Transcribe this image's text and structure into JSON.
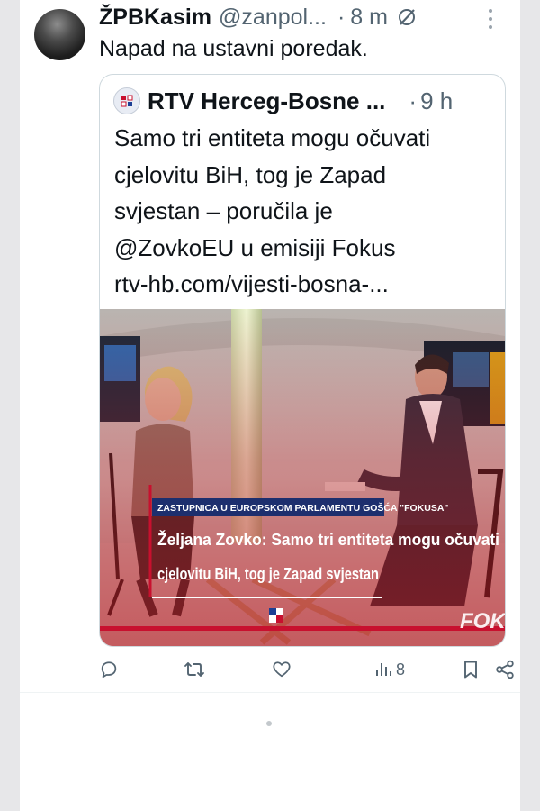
{
  "tweet": {
    "author_name": "ŽPBKasim",
    "author_handle": "@zanpol...",
    "separator": "·",
    "time": "8 m",
    "text": "Napad na ustavni poredak."
  },
  "quote": {
    "author_name": "RTV Herceg-Bosne ...",
    "separator": "·",
    "time": "9 h",
    "text_lines": [
      "Samo tri entiteta mogu očuvati",
      "cjelovitu BiH, tog je Zapad",
      "svjestan – poručila je",
      "@ZovkoEU u emisiji Fokus",
      "rtv-hb.com/vijesti-bosna-..."
    ],
    "image": {
      "subtitle_small": "ZASTUPNICA U EUROPSKOM PARLAMENTU GOŠĆA \"FOKUSA\"",
      "subtitle_line1": "Željana Zovko: Samo tri entiteta mogu očuvati",
      "subtitle_line2": "cjelovitu BiH, tog je Zapad svjestan",
      "watermark": "FOK"
    }
  },
  "actions": {
    "views_count": "8"
  },
  "icons": [
    "avatar",
    "grok-icon",
    "more-icon",
    "rtv-logo-icon",
    "reply-icon",
    "retweet-icon",
    "like-icon",
    "views-icon",
    "bookmark-icon",
    "share-icon"
  ],
  "colors": {
    "text_primary": "#0f1419",
    "text_secondary": "#536471",
    "border": "#cfd9de",
    "banner_red": "#b7131d",
    "background": "#ffffff"
  }
}
